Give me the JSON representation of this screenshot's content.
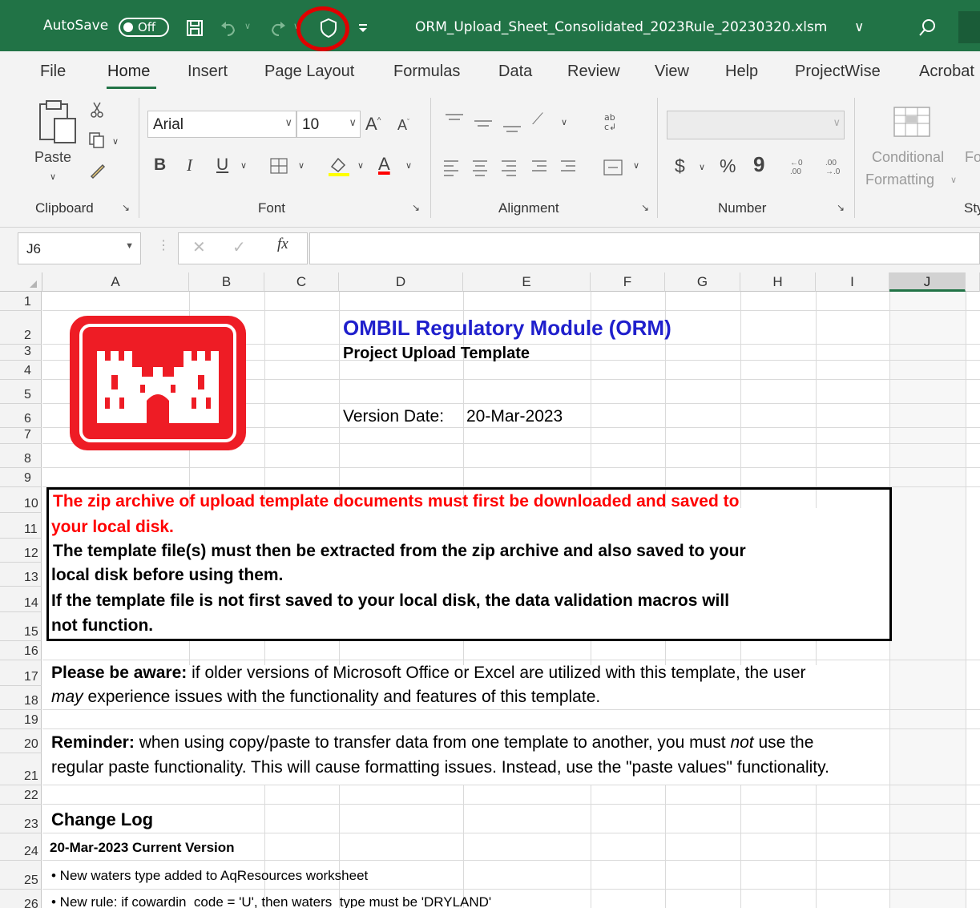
{
  "titlebar": {
    "autosave_label": "AutoSave",
    "autosave_state": "Off",
    "filename": "ORM_Upload_Sheet_Consolidated_2023Rule_20230320.xlsm",
    "filename_chevron": "∨",
    "background_color": "#217346",
    "highlight_color": "#e00000"
  },
  "menu": {
    "items": [
      "File",
      "Home",
      "Insert",
      "Page Layout",
      "Formulas",
      "Data",
      "Review",
      "View",
      "Help",
      "ProjectWise",
      "Acrobat"
    ],
    "active": "Home"
  },
  "ribbon": {
    "clipboard": {
      "paste_label": "Paste",
      "group_label": "Clipboard"
    },
    "font": {
      "font_name": "Arial",
      "font_size": "10",
      "group_label": "Font",
      "bold": "B",
      "italic": "I",
      "underline": "U"
    },
    "alignment": {
      "group_label": "Alignment"
    },
    "number": {
      "format_value": "",
      "currency": "$",
      "percent": "%",
      "comma": "9",
      "group_label": "Number"
    },
    "styles": {
      "conditional_line1": "Conditional",
      "conditional_line2": "Formatting",
      "fo_partial": "Fo",
      "group_label_partial": "Sty"
    }
  },
  "formula_bar": {
    "name_box": "J6",
    "formula": "",
    "fx": "fx"
  },
  "columns": [
    "A",
    "B",
    "C",
    "D",
    "E",
    "F",
    "G",
    "H",
    "I",
    "J"
  ],
  "selected_column": "J",
  "rows": [
    "1",
    "2",
    "3",
    "4",
    "5",
    "6",
    "7",
    "8",
    "9",
    "10",
    "11",
    "12",
    "13",
    "14",
    "15",
    "16",
    "17",
    "18",
    "19",
    "20",
    "21",
    "22",
    "23",
    "24",
    "25",
    "26"
  ],
  "sheet": {
    "title": "OMBIL Regulatory Module (ORM)",
    "subtitle": "Project Upload Template",
    "version_label": "Version Date:",
    "version_value": "20-Mar-2023",
    "notice": {
      "line10": "The zip archive of upload template documents must first be downloaded and saved to",
      "line11": "your local disk.",
      "line12": "The template file(s) must then be extracted from the zip archive and also saved to your",
      "line13": "local disk before using them.",
      "line14": "If the template file is not first saved to your local disk, the data validation macros will",
      "line15": "not function."
    },
    "aware_bold": "Please be aware:",
    "aware_text": " if older versions of Microsoft Office or Excel are utilized with this template, the user",
    "aware_may": "may",
    "aware_text2": " experience issues with the functionality and features of this template.",
    "reminder_bold": "Reminder:",
    "reminder_text": " when using copy/paste to transfer data from one template to another, you must ",
    "reminder_not": "not",
    "reminder_text2": " use the",
    "reminder_line2": "regular paste functionality. This will cause formatting issues. Instead, use the \"paste values\" functionality.",
    "changelog_title": "Change Log",
    "changelog_version": "20-Mar-2023 Current Version",
    "changelog_item1": "• New waters type added to AqResources worksheet",
    "changelog_item2": "• New rule: if cowardin_code = 'U', then waters_type must be 'DRYLAND'"
  }
}
